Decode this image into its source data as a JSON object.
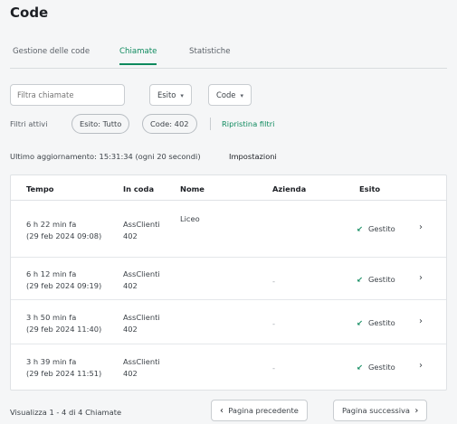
{
  "page": {
    "title": "Code"
  },
  "tabs": [
    {
      "label": "Gestione delle code",
      "active": false
    },
    {
      "label": "Chiamate",
      "active": true
    },
    {
      "label": "Statistiche",
      "active": false
    }
  ],
  "filters": {
    "search_placeholder": "Filtra chiamate",
    "esito_label": "Esito",
    "code_label": "Code",
    "active_label": "Filtri attivi",
    "chips": [
      "Esito: Tutto",
      "Code: 402"
    ],
    "reset_label": "Ripristina filtri"
  },
  "status_line": {
    "updated": "Ultimo aggiornamento: 15:31:34 (ogni 20 secondi)",
    "settings_label": "Impostazioni"
  },
  "table": {
    "headers": {
      "tempo": "Tempo",
      "in_coda": "In coda",
      "nome": "Nome",
      "azienda": "Azienda",
      "esito": "Esito"
    },
    "rows": [
      {
        "time_ago": "6 h 22 min fa",
        "timestamp": "(29 feb 2024 09:08)",
        "queue_name": "AssClienti",
        "queue_num": "402",
        "nome": "Liceo",
        "azienda": "",
        "esito": "Gestito"
      },
      {
        "time_ago": "6 h 12 min fa",
        "timestamp": "(29 feb 2024 09:19)",
        "queue_name": "AssClienti",
        "queue_num": "402",
        "nome": "",
        "azienda": "-",
        "esito": "Gestito"
      },
      {
        "time_ago": "3 h 50 min fa",
        "timestamp": "(29 feb 2024 11:40)",
        "queue_name": "AssClienti",
        "queue_num": "402",
        "nome": "",
        "azienda": "-",
        "esito": "Gestito"
      },
      {
        "time_ago": "3 h 39 min fa",
        "timestamp": "(29 feb 2024 11:51)",
        "queue_name": "AssClienti",
        "queue_num": "402",
        "nome": "",
        "azienda": "-",
        "esito": "Gestito"
      }
    ]
  },
  "pagination": {
    "summary": "Visualizza 1 - 4 di 4 Chiamate",
    "prev_label": "Pagina precedente",
    "next_label": "Pagina successiva"
  },
  "colors": {
    "accent": "#0e8a5e",
    "border": "#dfe2e5",
    "background": "#f5f6f7"
  },
  "icons": {
    "chevron_down": "chevron-down-icon",
    "chevron_right": "chevron-right-icon",
    "chevron_left": "chevron-left-icon",
    "status_check": "check-arrow-icon"
  }
}
